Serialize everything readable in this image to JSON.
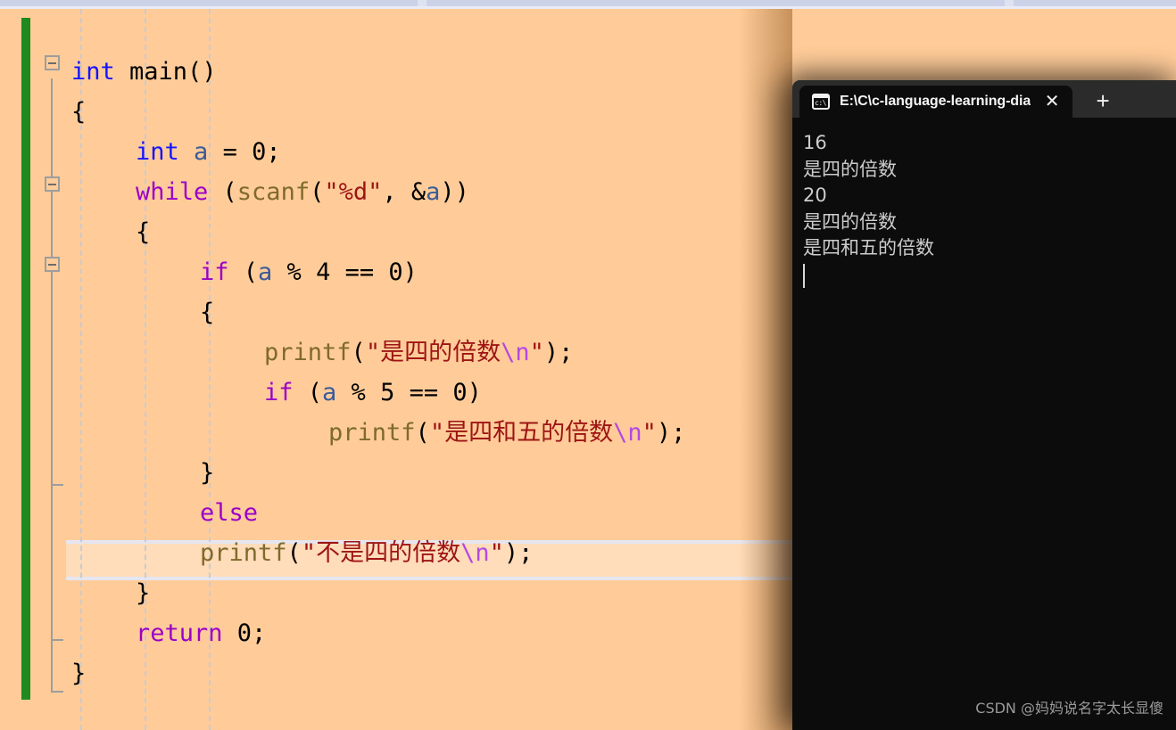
{
  "editor": {
    "background_color": "#ffcc99",
    "change_indicator_color": "#1f8a1f",
    "current_line_number": 13,
    "lines": [
      {
        "indent": 0,
        "tokens": [
          {
            "t": "int",
            "c": "type"
          },
          {
            "t": " main()",
            "c": "plain"
          }
        ]
      },
      {
        "indent": 0,
        "tokens": [
          {
            "t": "{",
            "c": "plain"
          }
        ]
      },
      {
        "indent": 1,
        "tokens": [
          {
            "t": "int",
            "c": "type"
          },
          {
            "t": " ",
            "c": "plain"
          },
          {
            "t": "a",
            "c": "var"
          },
          {
            "t": " = 0;",
            "c": "plain"
          }
        ]
      },
      {
        "indent": 1,
        "tokens": [
          {
            "t": "while",
            "c": "kw"
          },
          {
            "t": " (",
            "c": "plain"
          },
          {
            "t": "scanf",
            "c": "fn"
          },
          {
            "t": "(",
            "c": "plain"
          },
          {
            "t": "\"%d\"",
            "c": "str"
          },
          {
            "t": ", &",
            "c": "plain"
          },
          {
            "t": "a",
            "c": "var"
          },
          {
            "t": "))",
            "c": "plain"
          }
        ]
      },
      {
        "indent": 1,
        "tokens": [
          {
            "t": "{",
            "c": "plain"
          }
        ]
      },
      {
        "indent": 2,
        "tokens": [
          {
            "t": "if",
            "c": "kw"
          },
          {
            "t": " (",
            "c": "plain"
          },
          {
            "t": "a",
            "c": "var"
          },
          {
            "t": " % 4 == 0)",
            "c": "plain"
          }
        ]
      },
      {
        "indent": 2,
        "tokens": [
          {
            "t": "{",
            "c": "plain"
          }
        ]
      },
      {
        "indent": 3,
        "tokens": [
          {
            "t": "printf",
            "c": "fn"
          },
          {
            "t": "(",
            "c": "plain"
          },
          {
            "t": "\"是四的倍数",
            "c": "str"
          },
          {
            "t": "\\n",
            "c": "esc"
          },
          {
            "t": "\"",
            "c": "str"
          },
          {
            "t": ");",
            "c": "plain"
          }
        ]
      },
      {
        "indent": 3,
        "tokens": [
          {
            "t": "if",
            "c": "kw"
          },
          {
            "t": " (",
            "c": "plain"
          },
          {
            "t": "a",
            "c": "var"
          },
          {
            "t": " % 5 == 0)",
            "c": "plain"
          }
        ]
      },
      {
        "indent": 4,
        "tokens": [
          {
            "t": "printf",
            "c": "fn"
          },
          {
            "t": "(",
            "c": "plain"
          },
          {
            "t": "\"是四和五的倍数",
            "c": "str"
          },
          {
            "t": "\\n",
            "c": "esc"
          },
          {
            "t": "\"",
            "c": "str"
          },
          {
            "t": ");",
            "c": "plain"
          }
        ]
      },
      {
        "indent": 2,
        "tokens": [
          {
            "t": "}",
            "c": "plain"
          }
        ]
      },
      {
        "indent": 2,
        "tokens": [
          {
            "t": "else",
            "c": "kw"
          }
        ]
      },
      {
        "indent": 2,
        "tokens": [
          {
            "t": "printf",
            "c": "fn"
          },
          {
            "t": "(",
            "c": "plain"
          },
          {
            "t": "\"不是四的倍数",
            "c": "str"
          },
          {
            "t": "\\n",
            "c": "esc"
          },
          {
            "t": "\"",
            "c": "str"
          },
          {
            "t": ");",
            "c": "plain"
          }
        ]
      },
      {
        "indent": 1,
        "tokens": [
          {
            "t": "}",
            "c": "plain"
          }
        ]
      },
      {
        "indent": 1,
        "tokens": [
          {
            "t": "return",
            "c": "kw"
          },
          {
            "t": " 0;",
            "c": "plain"
          }
        ]
      },
      {
        "indent": 0,
        "tokens": [
          {
            "t": "}",
            "c": "plain"
          }
        ]
      }
    ],
    "fold_markers": [
      {
        "line": 0,
        "label": "collapse-main"
      },
      {
        "line": 3,
        "label": "collapse-while"
      },
      {
        "line": 5,
        "label": "collapse-if"
      }
    ]
  },
  "console": {
    "tab": {
      "icon": "console-cmd-icon",
      "title": "E:\\C\\c-language-learning-dia",
      "close_label": "✕",
      "new_tab_label": "+"
    },
    "output_lines": [
      "16",
      "是四的倍数",
      "20",
      "是四的倍数",
      "是四和五的倍数"
    ],
    "background_color": "#0c0c0c",
    "text_color": "#cccccc"
  },
  "watermark": {
    "text": "CSDN @妈妈说名字太长显傻"
  }
}
